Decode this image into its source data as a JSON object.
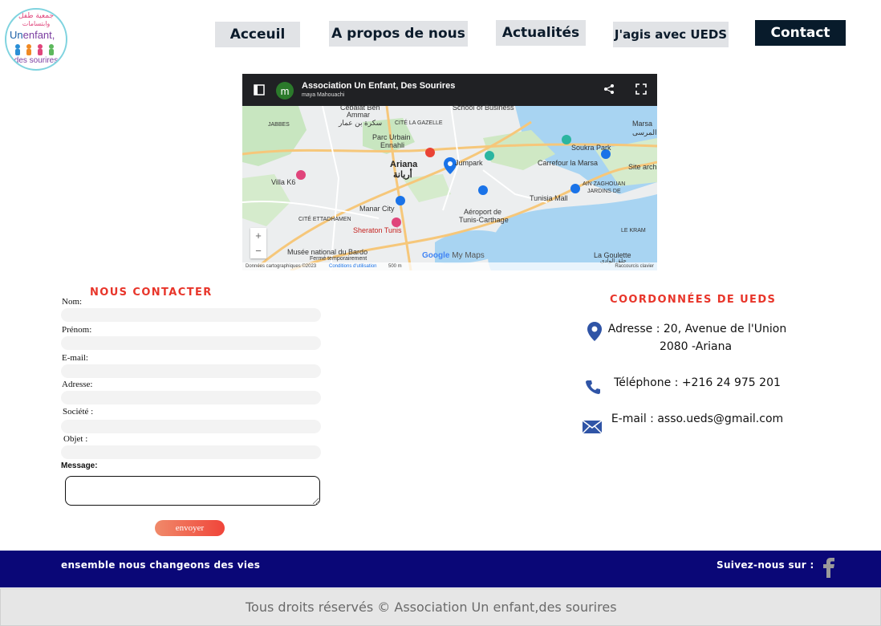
{
  "logo": {
    "arabic_line1": "جمعية طفل",
    "arabic_line2": "وابتسامات",
    "name_un": "Un",
    "name_enfant": "enfant,",
    "name_sourires": "des sourires"
  },
  "nav": {
    "items": [
      {
        "label": "Acceuil"
      },
      {
        "label": "A propos de nous"
      },
      {
        "label": "Actualités"
      },
      {
        "label": "J'agis avec UEDS"
      },
      {
        "label": "Contact"
      }
    ]
  },
  "map": {
    "title": "Association Un Enfant, Des Sourires",
    "subtitle": "maya Mahouachi",
    "avatar_letter": "m",
    "places": {
      "cebalat": "Cebalat Ben",
      "ammar": "Ammar",
      "ammar_ar": "سكرة بن عمار",
      "school": "School of Business",
      "marsa": "Marsa",
      "marsa_ar": "المرسى",
      "jabbes": "JABBES",
      "gazelle": "CITÉ LA GAZELLE",
      "parc": "Parc Urbain",
      "ennahli": "Ennahli",
      "soukra": "Soukra Park",
      "jumpark": "Jumpark",
      "carrefour": "Carrefour la Marsa",
      "ariana": "Ariana",
      "ariana_ar": "أريانة",
      "site": "Site arch",
      "villa": "Villa K6",
      "zaghouan": "AIN ZAGHOUAN",
      "jardins": "JARDINS DE",
      "tunisia_mall": "Tunisia Mall",
      "manar": "Manar City",
      "aeroport": "Aéroport de",
      "tunis_carthage": "Tunis-Carthage",
      "ettadhamen": "CITÉ ETTADHAMEN",
      "sheraton": "Sheraton Tunis",
      "kram": "LE KRAM",
      "bardo": "Musée national du Bardo",
      "ferme": "Fermé temporairement",
      "goulette": "La Goulette",
      "goulette_ar": "حلق الوادي",
      "gmaps_google": "Google",
      "gmaps_mymaps": "My Maps"
    },
    "zoom_in": "+",
    "zoom_out": "−",
    "footer_left": "Données cartographiques ©2023",
    "footer_mid": "Conditions d'utilisation",
    "footer_scale": "500 m",
    "footer_right": "Raccourcis clavier"
  },
  "form": {
    "title": "NOUS CONTACTER",
    "fields": [
      {
        "label": "Nom:",
        "value": ""
      },
      {
        "label": "Prénom:",
        "value": ""
      },
      {
        "label": "E-mail:",
        "value": ""
      },
      {
        "label": "Adresse:",
        "value": ""
      },
      {
        "label": "Société :",
        "value": ""
      },
      {
        "label": "Objet :",
        "value": ""
      }
    ],
    "message_label": "Message:",
    "message_value": "",
    "submit_label": "envoyer"
  },
  "contact": {
    "title": "COORDONNÉES DE UEDS",
    "address_line1": "Adresse : 20, Avenue de l'Union",
    "address_line2": "2080 -Ariana",
    "phone": "Téléphone : +216 24 975 201",
    "email": "E-mail : asso.ueds@gmail.com"
  },
  "footer": {
    "slogan": "ensemble nous changeons des vies",
    "follow": "Suivez-nous sur :",
    "social_icon": "facebook-icon",
    "copyright": "Tous droits réservés © Association Un enfant,des sourires"
  },
  "colors": {
    "nav_bg": "#e1e3e6",
    "nav_active": "#081b2b",
    "accent_red": "#e8352a",
    "footer_band": "#0a0777",
    "icon_blue": "#2f54a6"
  }
}
